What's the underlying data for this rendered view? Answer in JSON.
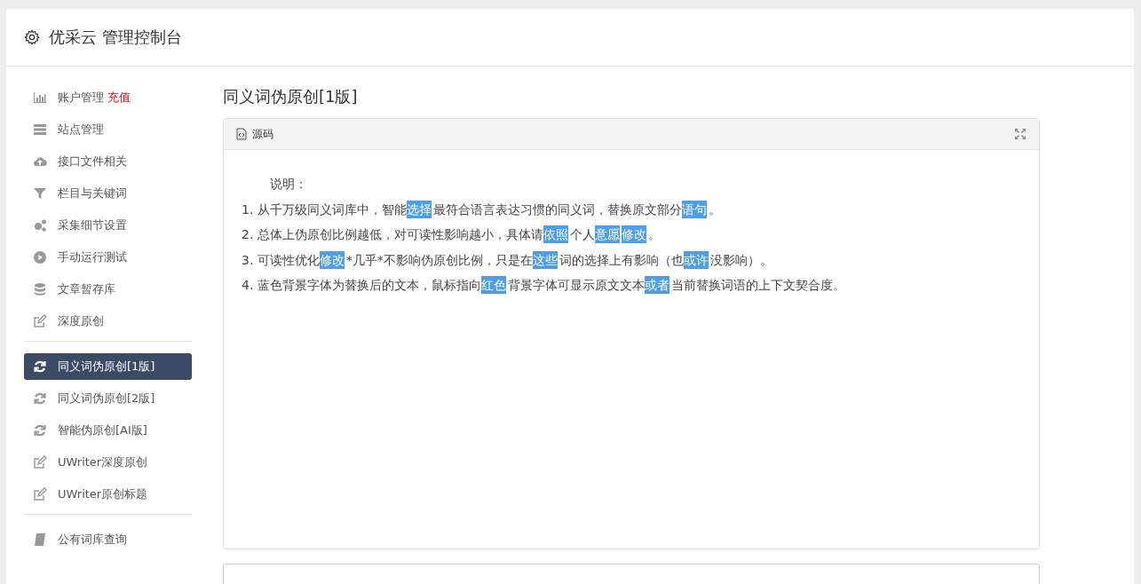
{
  "header": {
    "title": "优采云 管理控制台"
  },
  "sidebar": {
    "groups": [
      {
        "items": [
          {
            "label": "账户管理",
            "badge": "充值",
            "selected": false
          },
          {
            "label": "站点管理",
            "selected": false
          },
          {
            "label": "接口文件相关",
            "selected": false
          },
          {
            "label": "栏目与关键词",
            "selected": false
          },
          {
            "label": "采集细节设置",
            "selected": false
          },
          {
            "label": "手动运行测试",
            "selected": false
          },
          {
            "label": "文章暂存库",
            "selected": false
          },
          {
            "label": "深度原创",
            "selected": false
          }
        ]
      },
      {
        "items": [
          {
            "label": "同义词伪原创[1版]",
            "selected": true
          },
          {
            "label": "同义词伪原创[2版]",
            "selected": false
          },
          {
            "label": "智能伪原创[AI版]",
            "selected": false
          },
          {
            "label": "UWriter深度原创",
            "selected": false
          },
          {
            "label": "UWriter原创标题",
            "selected": false
          }
        ]
      },
      {
        "items": [
          {
            "label": "公有词库查询",
            "selected": false
          }
        ]
      }
    ]
  },
  "main": {
    "title": "同义词伪原创[1版]",
    "panel": {
      "tab": "源码",
      "intro": "说明：",
      "lines": [
        [
          {
            "t": "1. 从千万级同义词库中，智能",
            "hl": false
          },
          {
            "t": "选择",
            "hl": true
          },
          {
            "t": "最符合语言表达习惯的同义词，替换原文部分",
            "hl": false
          },
          {
            "t": "语句",
            "hl": true
          },
          {
            "t": "。",
            "hl": false
          }
        ],
        [
          {
            "t": "2. 总体上伪原创比例越低，对可读性影响越小，具体请",
            "hl": false
          },
          {
            "t": "依照",
            "hl": true
          },
          {
            "t": "个人",
            "hl": false
          },
          {
            "t": "意愿",
            "hl": true
          },
          {
            "t": "修改",
            "hl": true
          },
          {
            "t": "。",
            "hl": false
          }
        ],
        [
          {
            "t": "3. 可读性优化",
            "hl": false
          },
          {
            "t": "修改",
            "hl": true
          },
          {
            "t": "*几乎*不影响伪原创比例，只是在",
            "hl": false
          },
          {
            "t": "这些",
            "hl": true
          },
          {
            "t": "词的选择上有影响（也",
            "hl": false
          },
          {
            "t": "或许",
            "hl": true
          },
          {
            "t": "没影响）。",
            "hl": false
          }
        ],
        [
          {
            "t": "4. 蓝色背景字体为替换后的文本，鼠标指向",
            "hl": false
          },
          {
            "t": "红色",
            "hl": true
          },
          {
            "t": "背景字体可显示原文文本",
            "hl": false
          },
          {
            "t": "或者",
            "hl": true
          },
          {
            "t": "当前替换词语的上下文契合度。",
            "hl": false
          }
        ]
      ]
    }
  }
}
